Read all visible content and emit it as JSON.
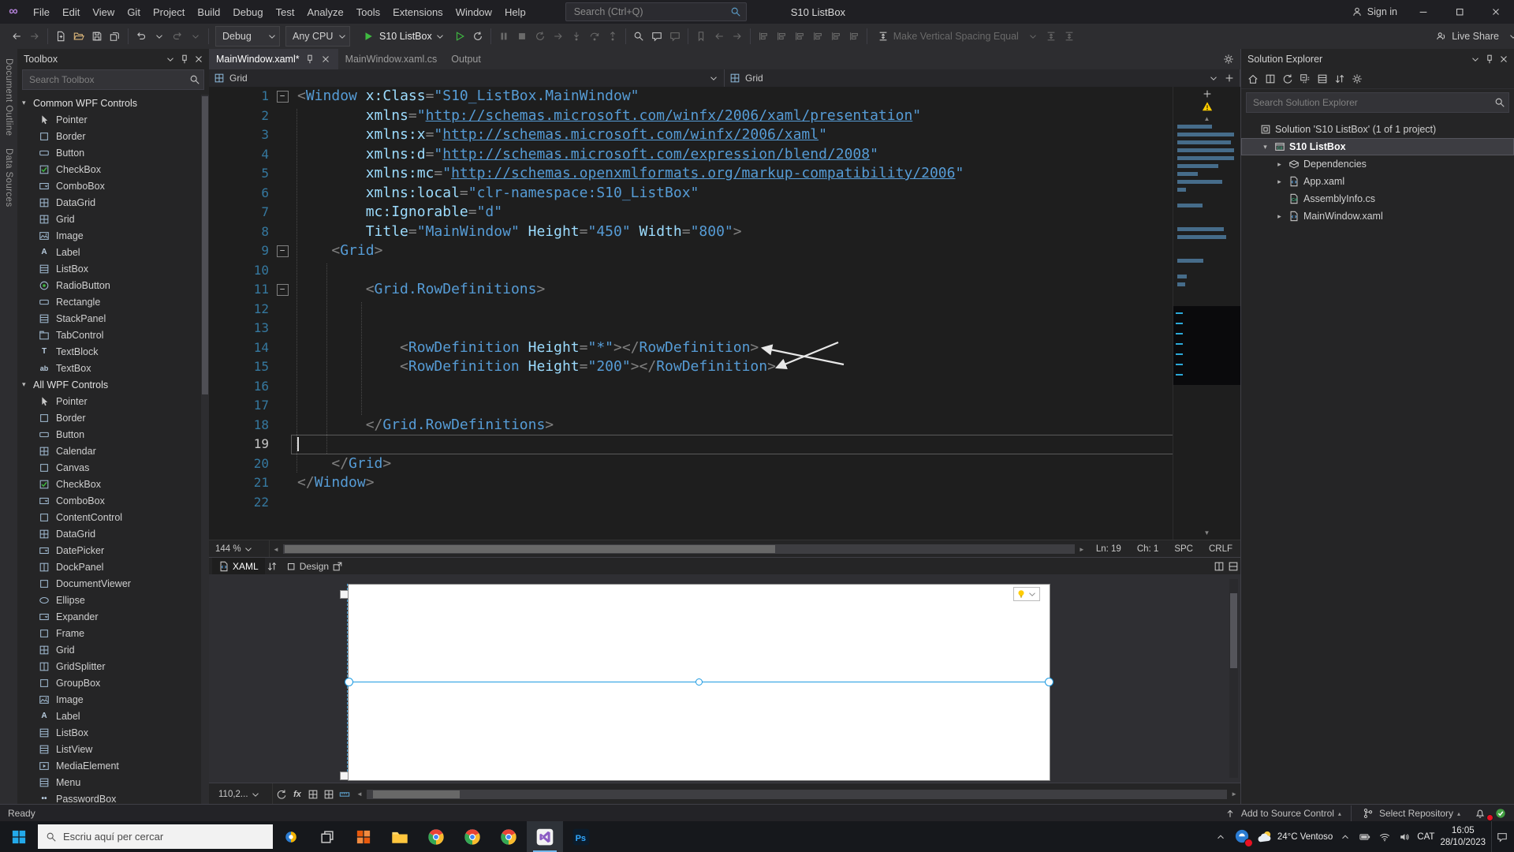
{
  "colors": {
    "accent": "#007acc",
    "editor_bg": "#1e1e1e",
    "panel_bg": "#252526",
    "xml_tag": "#569cd6",
    "xml_attribute": "#9cdcfe",
    "xml_delimiter": "#808080",
    "line_number": "#35789f",
    "warning": "#ffcc00",
    "start_green": "#3fba41"
  },
  "window": {
    "menus": [
      "File",
      "Edit",
      "View",
      "Git",
      "Project",
      "Build",
      "Debug",
      "Test",
      "Analyze",
      "Tools",
      "Extensions",
      "Window",
      "Help"
    ],
    "search_placeholder": "Search (Ctrl+Q)",
    "title": "S10 ListBox",
    "sign_in": "Sign in"
  },
  "toolbar": {
    "items": [
      {
        "t": "ic",
        "n": "nav-back-icon",
        "i": "back"
      },
      {
        "t": "ic",
        "n": "nav-forward-icon",
        "i": "fwd",
        "dim": 1
      },
      {
        "t": "sep"
      },
      {
        "t": "ic",
        "n": "new-file-icon",
        "i": "newfile"
      },
      {
        "t": "ic",
        "n": "open-folder-icon",
        "i": "openfolder",
        "c": "#dcb67a"
      },
      {
        "t": "ic",
        "n": "save-icon",
        "i": "save"
      },
      {
        "t": "ic",
        "n": "save-all-icon",
        "i": "saveall"
      },
      {
        "t": "sep"
      },
      {
        "t": "ic",
        "n": "undo-icon",
        "i": "undo"
      },
      {
        "t": "ic",
        "n": "undo-dropdown-icon",
        "i": "chev"
      },
      {
        "t": "ic",
        "n": "redo-icon",
        "i": "redo",
        "dim": 1
      },
      {
        "t": "ic",
        "n": "redo-dropdown-icon",
        "i": "chev",
        "dim": 1
      },
      {
        "t": "sep"
      },
      {
        "t": "dd",
        "n": "solution-configurations-dropdown",
        "label": "Debug"
      },
      {
        "t": "dd",
        "n": "solution-platforms-dropdown",
        "label": "Any CPU"
      },
      {
        "t": "start",
        "n": "start-debugging-button",
        "label": "S10 ListBox"
      },
      {
        "t": "ic",
        "n": "start-without-debugging-icon",
        "i": "playo"
      },
      {
        "t": "ic",
        "n": "hot-reload-icon",
        "i": "restart"
      },
      {
        "t": "sep"
      },
      {
        "t": "ic",
        "n": "break-all-icon",
        "i": "pause",
        "dim": 1
      },
      {
        "t": "ic",
        "n": "stop-debugging-icon",
        "i": "stop",
        "dim": 1
      },
      {
        "t": "ic",
        "n": "restart-debugging-icon",
        "i": "restart",
        "dim": 1
      },
      {
        "t": "ic",
        "n": "show-next-statement-icon",
        "i": "fwd",
        "dim": 1
      },
      {
        "t": "ic",
        "n": "step-into-icon",
        "i": "stepinto",
        "dim": 1
      },
      {
        "t": "ic",
        "n": "step-over-icon",
        "i": "stepover",
        "dim": 1
      },
      {
        "t": "ic",
        "n": "step-out-icon",
        "i": "stepout",
        "dim": 1
      },
      {
        "t": "sep"
      },
      {
        "t": "ic",
        "n": "find-in-files-icon",
        "i": "search"
      },
      {
        "t": "ic",
        "n": "comment-out-icon",
        "i": "comment"
      },
      {
        "t": "ic",
        "n": "uncomment-icon",
        "i": "comment",
        "dim": 1
      },
      {
        "t": "sep"
      },
      {
        "t": "ic",
        "n": "toggle-bookmark-icon",
        "i": "bookmark",
        "dim": 1
      },
      {
        "t": "ic",
        "n": "previous-bookmark-icon",
        "i": "back",
        "dim": 1
      },
      {
        "t": "ic",
        "n": "next-bookmark-icon",
        "i": "fwd",
        "dim": 1
      },
      {
        "t": "sep"
      },
      {
        "t": "ic",
        "n": "align-lefts-icon",
        "i": "align",
        "dim": 1
      },
      {
        "t": "ic",
        "n": "align-centers-icon",
        "i": "align",
        "dim": 1
      },
      {
        "t": "ic",
        "n": "align-rights-icon",
        "i": "align",
        "dim": 1
      },
      {
        "t": "ic",
        "n": "align-tops-icon",
        "i": "align",
        "dim": 1
      },
      {
        "t": "ic",
        "n": "align-middles-icon",
        "i": "align",
        "dim": 1
      },
      {
        "t": "ic",
        "n": "align-bottoms-icon",
        "i": "align",
        "dim": 1
      },
      {
        "t": "sep"
      },
      {
        "t": "lbl",
        "n": "make-vertical-spacing-equal-button",
        "i": "spacing",
        "label": "Make Vertical Spacing Equal",
        "dim": 1
      },
      {
        "t": "ic",
        "n": "spacing-options-chevron-icon",
        "i": "chev",
        "dim": 1
      },
      {
        "t": "ic",
        "n": "increase-vertical-spacing-icon",
        "i": "spacing",
        "dim": 1
      },
      {
        "t": "ic",
        "n": "decrease-vertical-spacing-icon",
        "i": "spacing",
        "dim": 1
      },
      {
        "t": "flex"
      },
      {
        "t": "lbl",
        "n": "live-share-button",
        "i": "liveshare",
        "label": "Live Share"
      },
      {
        "t": "ic",
        "n": "toolbar-overflow-icon",
        "i": "chev"
      }
    ]
  },
  "left_strip": {
    "tabs": [
      "Document Outline",
      "Data Sources"
    ]
  },
  "toolbox": {
    "title": "Toolbox",
    "search_placeholder": "Search Toolbox",
    "groups": [
      {
        "label": "Common WPF Controls",
        "items": [
          "Pointer",
          "Border",
          "Button",
          "CheckBox",
          "ComboBox",
          "DataGrid",
          "Grid",
          "Image",
          "Label",
          "ListBox",
          "RadioButton",
          "Rectangle",
          "StackPanel",
          "TabControl",
          "TextBlock",
          "TextBox"
        ]
      },
      {
        "label": "All WPF Controls",
        "items": [
          "Pointer",
          "Border",
          "Button",
          "Calendar",
          "Canvas",
          "CheckBox",
          "ComboBox",
          "ContentControl",
          "DataGrid",
          "DatePicker",
          "DockPanel",
          "DocumentViewer",
          "Ellipse",
          "Expander",
          "Frame",
          "Grid",
          "GridSplitter",
          "GroupBox",
          "Image",
          "Label",
          "ListBox",
          "ListView",
          "MediaElement",
          "Menu",
          "PasswordBox"
        ]
      }
    ]
  },
  "editor": {
    "tabs": [
      {
        "label": "MainWindow.xaml*",
        "state": "active"
      },
      {
        "label": "MainWindow.xaml.cs"
      },
      {
        "label": "Output"
      }
    ],
    "breadcrumbs": [
      "Grid",
      "Grid"
    ],
    "zoom": "144 %",
    "caret_status": {
      "ln": "Ln: 19",
      "ch": "Ch: 1",
      "spc": "SPC",
      "eol": "CRLF"
    },
    "code": [
      {
        "n": 1,
        "fold": true,
        "tok": [
          [
            "d",
            "<"
          ],
          [
            "t",
            "Window"
          ],
          [
            "p",
            " "
          ],
          [
            "a",
            "x:Class"
          ],
          [
            "d",
            "="
          ],
          [
            "v",
            "\"S10_ListBox.MainWindow\""
          ]
        ]
      },
      {
        "n": 2,
        "tok": [
          [
            "p",
            "        "
          ],
          [
            "a",
            "xmlns"
          ],
          [
            "d",
            "="
          ],
          [
            "v",
            "\""
          ],
          [
            "u",
            "http://schemas.microsoft.com/winfx/2006/xaml/presentation"
          ],
          [
            "v",
            "\""
          ]
        ]
      },
      {
        "n": 3,
        "tok": [
          [
            "p",
            "        "
          ],
          [
            "a",
            "xmlns:x"
          ],
          [
            "d",
            "="
          ],
          [
            "v",
            "\""
          ],
          [
            "u",
            "http://schemas.microsoft.com/winfx/2006/xaml"
          ],
          [
            "v",
            "\""
          ]
        ]
      },
      {
        "n": 4,
        "tok": [
          [
            "p",
            "        "
          ],
          [
            "a",
            "xmlns:d"
          ],
          [
            "d",
            "="
          ],
          [
            "v",
            "\""
          ],
          [
            "u",
            "http://schemas.microsoft.com/expression/blend/2008"
          ],
          [
            "v",
            "\""
          ]
        ]
      },
      {
        "n": 5,
        "tok": [
          [
            "p",
            "        "
          ],
          [
            "a",
            "xmlns:mc"
          ],
          [
            "d",
            "="
          ],
          [
            "v",
            "\""
          ],
          [
            "u",
            "http://schemas.openxmlformats.org/markup-compatibility/2006"
          ],
          [
            "v",
            "\""
          ]
        ]
      },
      {
        "n": 6,
        "tok": [
          [
            "p",
            "        "
          ],
          [
            "a",
            "xmlns:local"
          ],
          [
            "d",
            "="
          ],
          [
            "v",
            "\"clr-namespace:S10_ListBox\""
          ]
        ]
      },
      {
        "n": 7,
        "tok": [
          [
            "p",
            "        "
          ],
          [
            "a",
            "mc:Ignorable"
          ],
          [
            "d",
            "="
          ],
          [
            "v",
            "\"d\""
          ]
        ]
      },
      {
        "n": 8,
        "tok": [
          [
            "p",
            "        "
          ],
          [
            "a",
            "Title"
          ],
          [
            "d",
            "="
          ],
          [
            "v",
            "\"MainWindow\""
          ],
          [
            "p",
            " "
          ],
          [
            "a",
            "Height"
          ],
          [
            "d",
            "="
          ],
          [
            "v",
            "\"450\""
          ],
          [
            "p",
            " "
          ],
          [
            "a",
            "Width"
          ],
          [
            "d",
            "="
          ],
          [
            "v",
            "\"800\""
          ],
          [
            "d",
            ">"
          ]
        ]
      },
      {
        "n": 9,
        "fold": true,
        "tok": [
          [
            "p",
            "    "
          ],
          [
            "d",
            "<"
          ],
          [
            "t",
            "Grid"
          ],
          [
            "d",
            ">"
          ]
        ]
      },
      {
        "n": 10
      },
      {
        "n": 11,
        "fold": true,
        "tok": [
          [
            "p",
            "        "
          ],
          [
            "d",
            "<"
          ],
          [
            "t",
            "Grid.RowDefinitions"
          ],
          [
            "d",
            ">"
          ]
        ]
      },
      {
        "n": 12
      },
      {
        "n": 13
      },
      {
        "n": 14,
        "tok": [
          [
            "p",
            "            "
          ],
          [
            "d",
            "<"
          ],
          [
            "t",
            "RowDefinition"
          ],
          [
            "p",
            " "
          ],
          [
            "a",
            "Height"
          ],
          [
            "d",
            "="
          ],
          [
            "v",
            "\"*\""
          ],
          [
            "d",
            "></"
          ],
          [
            "t",
            "RowDefinition"
          ],
          [
            "d",
            ">"
          ]
        ]
      },
      {
        "n": 15,
        "tok": [
          [
            "p",
            "            "
          ],
          [
            "d",
            "<"
          ],
          [
            "t",
            "RowDefinition"
          ],
          [
            "p",
            " "
          ],
          [
            "a",
            "Height"
          ],
          [
            "d",
            "="
          ],
          [
            "v",
            "\"200\""
          ],
          [
            "d",
            "></"
          ],
          [
            "t",
            "RowDefinition"
          ],
          [
            "d",
            ">"
          ]
        ]
      },
      {
        "n": 16
      },
      {
        "n": 17
      },
      {
        "n": 18,
        "tok": [
          [
            "p",
            "        "
          ],
          [
            "d",
            "</"
          ],
          [
            "t",
            "Grid.RowDefinitions"
          ],
          [
            "d",
            ">"
          ]
        ]
      },
      {
        "n": 19,
        "current": true
      },
      {
        "n": 20,
        "tok": [
          [
            "p",
            "    "
          ],
          [
            "d",
            "</"
          ],
          [
            "t",
            "Grid"
          ],
          [
            "d",
            ">"
          ]
        ]
      },
      {
        "n": 21,
        "tok": [
          [
            "d",
            "</"
          ],
          [
            "t",
            "Window"
          ],
          [
            "d",
            ">"
          ]
        ]
      },
      {
        "n": 22
      }
    ]
  },
  "design": {
    "xaml_label": "XAML",
    "design_label": "Design",
    "zoom": "110,2..."
  },
  "solution_explorer": {
    "title": "Solution Explorer",
    "search_placeholder": "Search Solution Explorer",
    "toolbar_icons": [
      "home",
      "switch-views",
      "pending-changes",
      "collapse-all",
      "show-all-files",
      "sync-with-active-document",
      "properties"
    ],
    "tree": [
      {
        "icon": "solution",
        "label": "Solution 'S10 ListBox' (1 of 1 project)",
        "indent": 0
      },
      {
        "icon": "csproj",
        "label": "S10 ListBox",
        "indent": 1,
        "arrow": "down",
        "selected": true,
        "bold": true
      },
      {
        "icon": "dependencies",
        "label": "Dependencies",
        "indent": 2,
        "arrow": "right"
      },
      {
        "icon": "xamlfile",
        "label": "App.xaml",
        "indent": 2,
        "arrow": "right"
      },
      {
        "icon": "csfile",
        "label": "AssemblyInfo.cs",
        "indent": 2
      },
      {
        "icon": "xamlfile",
        "label": "MainWindow.xaml",
        "indent": 2,
        "arrow": "right"
      }
    ]
  },
  "status_bar": {
    "ready": "Ready",
    "add_to_source_control": "Add to Source Control",
    "select_repository": "Select Repository"
  },
  "taskbar": {
    "search_placeholder": "Escriu aquí per cercar",
    "apps": [
      {
        "icon": "searchhl",
        "name": "search-highlights-icon"
      },
      {
        "icon": "taskview",
        "name": "task-view-button"
      },
      {
        "icon": "orangeapp",
        "name": "app-icon-orange"
      },
      {
        "icon": "folderwin",
        "name": "file-explorer-icon"
      },
      {
        "icon": "chrome",
        "name": "chrome-icon"
      },
      {
        "icon": "chrome",
        "name": "chrome-profile-icon"
      },
      {
        "icon": "chrome",
        "name": "chrome-profile-2-icon"
      },
      {
        "icon": "vslogo",
        "name": "visual-studio-icon",
        "active": 1
      },
      {
        "icon": "pslogo",
        "name": "photoshop-icon"
      }
    ],
    "tray": {
      "weather": "24°C Ventoso",
      "language": "CAT",
      "time": "16:05",
      "date": "28/10/2023"
    }
  }
}
